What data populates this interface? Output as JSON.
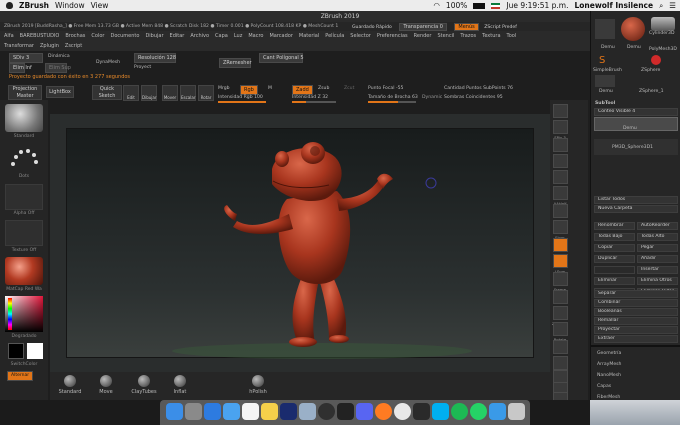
{
  "mac_menubar": {
    "apple": "",
    "app_name": "ZBrush",
    "menu_window": "Window",
    "menu_view": "View",
    "battery": "100%",
    "datetime": "Jue 9:19:51 p.m.",
    "user": "Lonewolf Insilence"
  },
  "window_title": "ZBrush 2019",
  "info_bar": "ZBrush 2019 [BuddRasha_] ● Free Mem 13.73 GB ● Active Mem 848 ● Scratch Disk 182 ● Timer 0.001 ● PolyCount 108.418 KP ● MeshCount 1",
  "info_bar_right": {
    "quick_save": "Guardado Rápido",
    "transparency": "Transparencia 0",
    "menus": "Menús",
    "zscript": "ZScript Predef"
  },
  "menus": [
    "Alfa",
    "BAREBUSTUDIO",
    "Brochas",
    "Color",
    "Documento",
    "Dibujar",
    "Editar",
    "Archivo",
    "Capa",
    "Luz",
    "Macro",
    "Marcador",
    "Material",
    "Película",
    "Selector",
    "Preferencias",
    "Render",
    "Stencil",
    "Trazos",
    "Textura",
    "Tool"
  ],
  "menus2": [
    "Transformar",
    "Zplugin",
    "Zscript"
  ],
  "top_controls": {
    "div": "SDiv 3",
    "dinamica": "Dinámica",
    "dyna_mesh": "DynaMesh",
    "resolution": "Resolución 128",
    "project": "Proyect",
    "zremesher": "ZRemesher",
    "target_polys": "Cant Polígonal 5",
    "del_lower": "Elim Inf",
    "del_higher": "Elim Sup"
  },
  "notice": "Proyecto guardado con éxito en 3 277 segundos",
  "shelf": {
    "projection_master": "Projection Master",
    "lightbox": "LightBox",
    "quick_sketch": "Quick Sketch",
    "edit": "Edit",
    "draw": "Dibujar",
    "move": "Mover",
    "scale": "Escalar",
    "rotate": "Rotar",
    "mrgb": "Mrgb",
    "rgb": "Rgb",
    "m": "M",
    "zadd": "Zadd",
    "zsub": "Zsub",
    "zcut": "Zcut",
    "rgb_intensity": "Intensidad Rgb 100",
    "z_intensity": "Intensidad Z 32",
    "focal_shift": "Punto Focal -55",
    "draw_size": "Tamaño de Brocha 63",
    "dynamic": "Dynamic",
    "active_points": "Cantidad Puntos SubPoints 76",
    "total_points": "Sombras Coincidentes 95"
  },
  "shelf_values": {
    "rgb_intensity": 100,
    "z_intensity": 32,
    "draw_size": 63
  },
  "left_tray": {
    "brush_label": "Standard",
    "stroke_label": "Dots",
    "alpha_label": "Alpha Off",
    "texture_label": "Texture Off",
    "material_label": "MatCap Red Wa",
    "gradient_label": "Degradado",
    "switch_color": "SwitchColor",
    "alternate": "Alternar"
  },
  "bottom_shelf": [
    "Standard",
    "Move",
    "ClayTubes",
    "Inflat",
    "hPolish"
  ],
  "right_tray": [
    "BPR",
    "SPix 3",
    "Scroll",
    "Zoom",
    "Actual",
    "AAHalf",
    "Persp",
    "Floor",
    "Local",
    "LSym",
    "Frame",
    "Move",
    "Zoom3D",
    "Rotate",
    "Line Fill PolyF",
    "Transp",
    "Ghost",
    "Solo",
    "Xpose"
  ],
  "right_panel": {
    "subtools_thumbs": [
      "Demu",
      "Cylinder3D",
      "Demu",
      "PolyMesh3D",
      "SimpleBrush",
      "ZSphere",
      "Demu",
      "ZSphere_1"
    ],
    "subtool_title": "SubTool",
    "visible_count": "Conteo Visible 4",
    "subtool_items": [
      "Demu",
      "PM3D_Sphere3D1"
    ],
    "buttons_a": [
      "Listar Todos",
      "Nueva Carpeta"
    ],
    "buttons_b": [
      [
        "Renombrar",
        "AutoReorder"
      ],
      [
        "Todas Bajo",
        "Todas Alto"
      ],
      [
        "Copiar",
        "Pegar"
      ],
      [
        "Duplicar",
        "Añadir"
      ],
      [
        "",
        "Insertar"
      ],
      [
        "Eliminar",
        "Elimina Otros"
      ],
      [
        "",
        "Eliminar Todos"
      ]
    ],
    "buttons_c": [
      "Separar",
      "Combinar",
      "Booleanas",
      "Remallar",
      "Proyectar",
      "Extraer"
    ],
    "sections": [
      "Geometría",
      "ArrayMesh",
      "NanoMesh",
      "Capas",
      "FiberMesh"
    ]
  },
  "colors": {
    "accent": "#e27518",
    "notice": "#e88a2a",
    "model": "#b23a22"
  },
  "dock_icons": [
    "finder-icon",
    "launchpad-icon",
    "safari-icon",
    "mail-icon",
    "calendar-icon",
    "notes-icon",
    "photoshop-icon",
    "preview-icon",
    "obs-icon",
    "terminal-icon",
    "discord-icon",
    "firefox-icon",
    "chrome-icon",
    "zbrush-icon",
    "skype-icon",
    "spotify-icon",
    "whatsapp-icon",
    "folder-icon",
    "trash-icon"
  ]
}
